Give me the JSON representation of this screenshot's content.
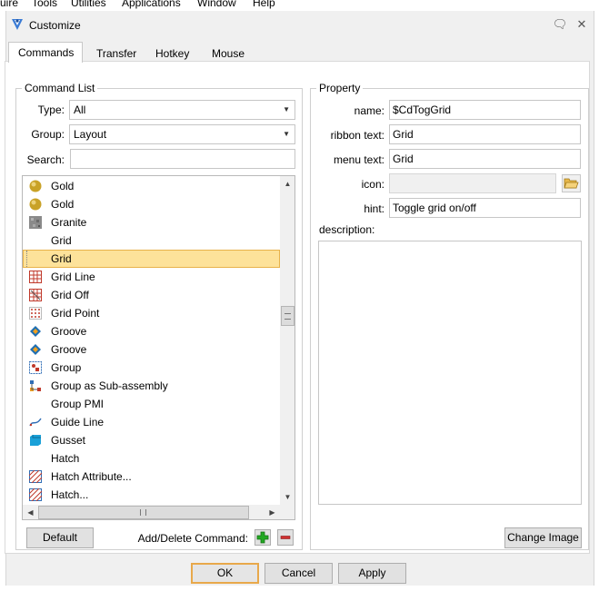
{
  "menubar": {
    "items": [
      "uire",
      "Tools",
      "Utilities",
      "Applications",
      "Window",
      "Help"
    ]
  },
  "dialog": {
    "title": "Customize",
    "help_glyph": "🗨",
    "close_glyph": "✕"
  },
  "tabs": [
    "Commands",
    "Transfer",
    "Hotkey",
    "Mouse"
  ],
  "command_list": {
    "legend": "Command List",
    "type_label": "Type:",
    "type_value": "All",
    "group_label": "Group:",
    "group_value": "Layout",
    "search_label": "Search:",
    "search_value": "",
    "items": [
      {
        "label": "Gold",
        "icon": "gold-sphere-icon"
      },
      {
        "label": "Gold",
        "icon": "gold-sphere-icon"
      },
      {
        "label": "Granite",
        "icon": "granite-texture-icon"
      },
      {
        "label": "Grid",
        "icon": ""
      },
      {
        "label": "Grid",
        "icon": "",
        "selected": true
      },
      {
        "label": "Grid Line",
        "icon": "grid-line-icon"
      },
      {
        "label": "Grid Off",
        "icon": "grid-off-icon"
      },
      {
        "label": "Grid Point",
        "icon": "grid-point-icon"
      },
      {
        "label": "Groove",
        "icon": "groove-icon"
      },
      {
        "label": "Groove",
        "icon": "groove-icon"
      },
      {
        "label": "Group",
        "icon": "group-icon"
      },
      {
        "label": "Group as Sub-assembly",
        "icon": "group-subassembly-icon"
      },
      {
        "label": "Group PMI",
        "icon": ""
      },
      {
        "label": "Guide Line",
        "icon": "guide-line-icon"
      },
      {
        "label": "Gusset",
        "icon": "gusset-icon"
      },
      {
        "label": "Hatch",
        "icon": ""
      },
      {
        "label": "Hatch Attribute...",
        "icon": "hatch-icon"
      },
      {
        "label": "Hatch...",
        "icon": "hatch-icon"
      }
    ],
    "default_button": "Default",
    "add_delete_label": "Add/Delete Command:"
  },
  "property": {
    "legend": "Property",
    "name_label": "name:",
    "name_value": "$CdTogGrid",
    "ribbon_text_label": "ribbon text:",
    "ribbon_text_value": "Grid",
    "menu_text_label": "menu text:",
    "menu_text_value": "Grid",
    "icon_label": "icon:",
    "icon_value": "",
    "hint_label": "hint:",
    "hint_value": "Toggle grid on/off",
    "description_label": "description:",
    "description_value": "",
    "change_image_button": "Change Image"
  },
  "footer": {
    "ok": "OK",
    "cancel": "Cancel",
    "apply": "Apply"
  },
  "colors": {
    "selection_fill": "#fde29a",
    "selection_border": "#e8b24a",
    "add_green": "#22a822",
    "delete_red": "#d03030"
  }
}
